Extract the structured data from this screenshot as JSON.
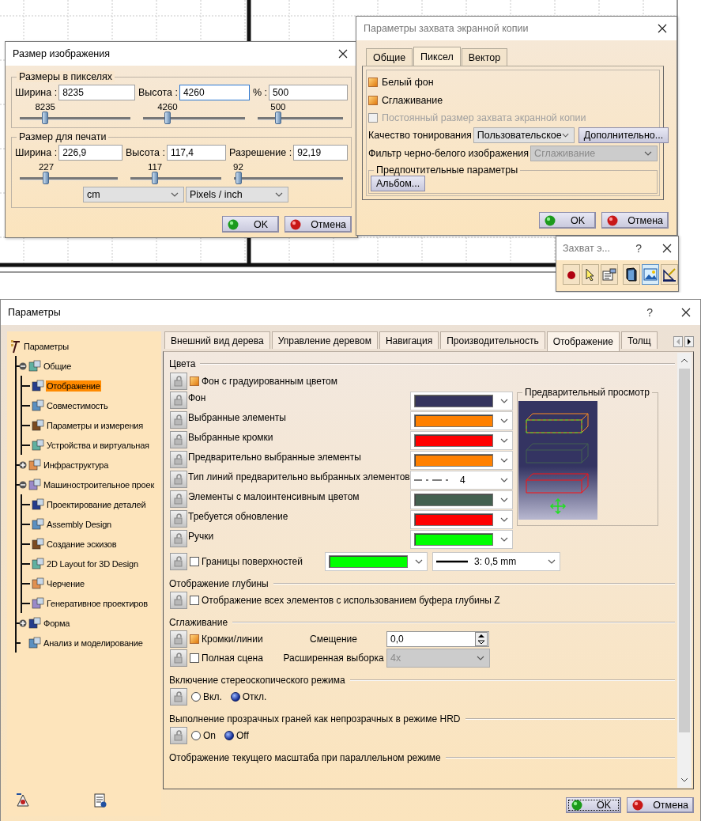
{
  "image_size_dialog": {
    "title": "Размер изображения",
    "pixel_group": {
      "legend": "Размеры в пикселях",
      "fields": [
        {
          "label": "Ширина :",
          "value": "8235",
          "focused": false,
          "slider_value": "8235",
          "level": 0.23
        },
        {
          "label": "Высота :",
          "value": "4260",
          "focused": true,
          "slider_value": "4260",
          "level": 0.24
        },
        {
          "label": "% :",
          "value": "500",
          "focused": false,
          "slider_value": "500",
          "level": 0.24
        }
      ]
    },
    "print_group": {
      "legend": "Размер для печати",
      "fields": [
        {
          "label": "Ширина :",
          "value": "226,9",
          "focused": false,
          "slider_value": "227",
          "level": 0.27
        },
        {
          "label": "Высота :",
          "value": "117,4",
          "focused": false,
          "slider_value": "117",
          "level": 0.27
        },
        {
          "label": "Разрешение :",
          "value": "92,19",
          "focused": false,
          "slider_value": "92",
          "level": 0.04
        }
      ],
      "dropdowns": [
        "cm",
        "Pixels / inch"
      ]
    },
    "buttons": [
      {
        "label": "OK",
        "kind": "ok",
        "focused": false
      },
      {
        "label": "Отмена",
        "kind": "cancel",
        "focused": false
      }
    ]
  },
  "capture_dialog": {
    "title": "Параметры захвата экранной копии",
    "tabs": [
      {
        "label": "Общие",
        "selected": false
      },
      {
        "label": "Пиксел",
        "selected": true
      },
      {
        "label": "Вектор",
        "selected": false
      }
    ],
    "options": [
      {
        "label": "Белый фон",
        "checked": true,
        "disabled": false
      },
      {
        "label": "Сглаживание",
        "checked": true,
        "disabled": false
      },
      {
        "label": "Постоянный размер захвата экранной копии",
        "checked": false,
        "disabled": true
      }
    ],
    "shading": {
      "label": "Качество тонирования",
      "value": "Пользовательское",
      "button": "Дополнительно..."
    },
    "filter": {
      "label": "Фильтр черно-белого изображения",
      "value": "Сглаживание",
      "disabled": true
    },
    "preferences": {
      "legend": "Предпочтительные параметры",
      "button": "Альбом..."
    },
    "buttons": [
      {
        "label": "OK",
        "kind": "ok",
        "focused": false
      },
      {
        "label": "Отмена",
        "kind": "cancel",
        "focused": false
      }
    ]
  },
  "capture_toolbar": {
    "title": "Захват э...",
    "help": "?",
    "tools": [
      {
        "kind": "record",
        "selected": false
      },
      {
        "kind": "select",
        "selected": false
      },
      {
        "kind": "options",
        "selected": false
      },
      {
        "kind": "book",
        "selected": false
      },
      {
        "kind": "image",
        "selected": true
      },
      {
        "kind": "ruler",
        "selected": false
      }
    ]
  },
  "options_dialog": {
    "title": "Параметры",
    "help": "?",
    "tree": {
      "label": "Параметры",
      "selected": false,
      "children": [
        {
          "label": "Общие",
          "selected": false,
          "expanded": true,
          "children": [
            {
              "label": "Отображение",
              "selected": true
            },
            {
              "label": "Совместимость",
              "selected": false
            },
            {
              "label": "Параметры и измерения",
              "selected": false
            },
            {
              "label": "Устройства и виртуальная",
              "selected": false
            }
          ]
        },
        {
          "label": "Инфраструктура",
          "selected": false,
          "expanded": false
        },
        {
          "label": "Машиностроительное проек",
          "selected": false,
          "expanded": true,
          "children": [
            {
              "label": "Проектирование деталей",
              "selected": false
            },
            {
              "label": "Assembly Design",
              "selected": false
            },
            {
              "label": "Создание эскизов",
              "selected": false
            },
            {
              "label": "2D Layout for 3D Design",
              "selected": false
            },
            {
              "label": "Черчение",
              "selected": false
            },
            {
              "label": "Генеративное проектиров",
              "selected": false
            }
          ]
        },
        {
          "label": "Форма",
          "selected": false,
          "expanded": false
        },
        {
          "label": "Анализ и моделирование",
          "selected": false
        }
      ]
    },
    "tabs": [
      {
        "label": "Внешний вид дерева",
        "selected": false
      },
      {
        "label": "Управление деревом",
        "selected": false
      },
      {
        "label": "Навигация",
        "selected": false
      },
      {
        "label": "Производительность",
        "selected": false
      },
      {
        "label": "Отображение",
        "selected": true
      },
      {
        "label": "Толщ",
        "selected": false
      }
    ],
    "sections": [
      {
        "title": "Цвета",
        "preview": {
          "legend": "Предварительный просмотр"
        },
        "rows": [
          {
            "kind": "check",
            "label": "Фон с градуированным цветом",
            "checked": true
          },
          {
            "kind": "color",
            "label": "Фон",
            "color": "#34345e"
          },
          {
            "kind": "color",
            "label": "Выбранные элементы",
            "color": "#ff8000"
          },
          {
            "kind": "color",
            "label": "Выбранные кромки",
            "color": "#ff0000"
          },
          {
            "kind": "color",
            "label": "Предварительно выбранные элементы",
            "color": "#ff8000"
          },
          {
            "kind": "linetype",
            "label": "Тип линий предварительно выбранных элементов",
            "value": "4"
          },
          {
            "kind": "color",
            "label": "Элементы с малоинтенсивным цветом",
            "color": "#436050"
          },
          {
            "kind": "color",
            "label": "Требуется обновление",
            "color": "#ff0000"
          },
          {
            "kind": "color",
            "label": "Ручки",
            "color": "#00ff00"
          },
          {
            "kind": "check_color_line",
            "label": "Границы поверхностей",
            "checked": false,
            "color": "#00ff00",
            "value": "3: 0,5 mm"
          }
        ]
      },
      {
        "title": "Отображение глубины",
        "rows": [
          {
            "kind": "check",
            "label": "Отображение всех элементов с использованием буфера глубины Z",
            "checked": false
          }
        ]
      },
      {
        "title": "Сглаживание",
        "rows": [
          {
            "kind": "check_spin",
            "label": "Кромки/линии",
            "checked": true,
            "field_label": "Смещение",
            "value": "0,0"
          },
          {
            "kind": "check_select",
            "label": "Полная сцена",
            "checked": false,
            "field_label": "Расширенная выборка",
            "value": "4x",
            "disabled": true
          }
        ]
      },
      {
        "title": "Включение стереоскопического режима",
        "rows": [
          {
            "kind": "radio",
            "options": [
              {
                "label": "Вкл.",
                "selected": false
              },
              {
                "label": "Откл.",
                "selected": true
              }
            ]
          }
        ]
      },
      {
        "title": "Выполнение прозрачных граней как непрозрачных в режиме HRD",
        "rows": [
          {
            "kind": "radio",
            "options": [
              {
                "label": "On",
                "selected": false
              },
              {
                "label": "Off",
                "selected": true
              }
            ]
          }
        ]
      },
      {
        "title": "Отображение текущего масштаба при параллельном режиме"
      }
    ],
    "buttons": [
      {
        "label": "OK",
        "kind": "ok",
        "focused": true
      },
      {
        "label": "Отмена",
        "kind": "cancel",
        "focused": false
      }
    ]
  }
}
